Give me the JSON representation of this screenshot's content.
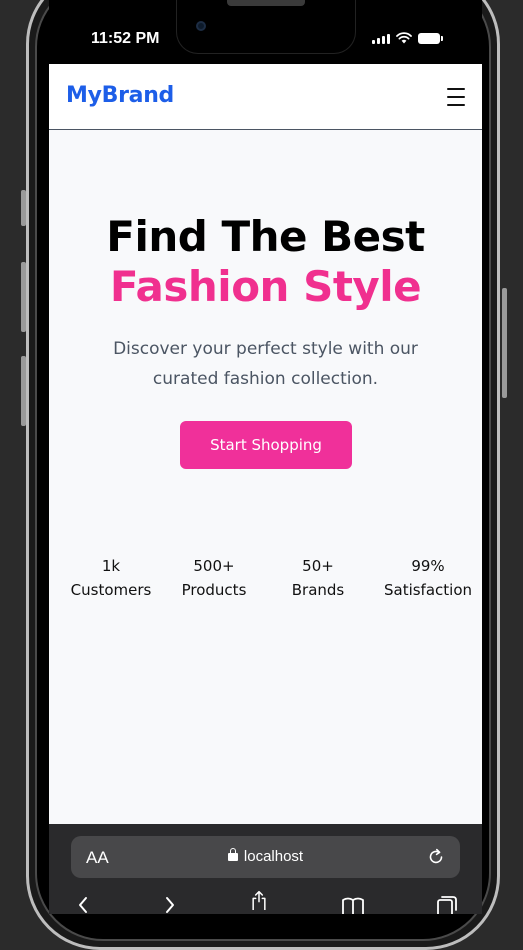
{
  "status_bar": {
    "time": "11:52 PM"
  },
  "navbar": {
    "brand": "MyBrand",
    "menu_icon": "hamburger-menu-icon"
  },
  "hero": {
    "title_line1": "Find The Best",
    "title_line2": "Fashion Style",
    "subtitle": "Discover your perfect style with our curated fashion collection.",
    "cta_label": "Start Shopping"
  },
  "stats": [
    {
      "value": "1k",
      "label": "Customers"
    },
    {
      "value": "500+",
      "label": "Products"
    },
    {
      "value": "50+",
      "label": "Brands"
    },
    {
      "value": "99%",
      "label": "Satisfaction"
    }
  ],
  "browser": {
    "text_size_label": "AA",
    "url": "localhost",
    "icons": [
      "lock-icon",
      "reload-icon",
      "back-icon",
      "forward-icon",
      "share-icon",
      "bookmarks-icon",
      "tabs-icon"
    ]
  },
  "colors": {
    "brand": "#1d5ee8",
    "accent": "#f0308f",
    "cta": "#f0309a",
    "page_background": "#f8f9fb",
    "browser_bar": "#2a2a2c"
  }
}
